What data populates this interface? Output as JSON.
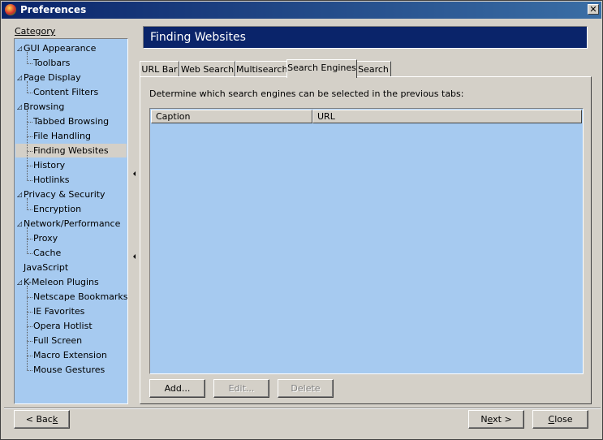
{
  "window": {
    "title": "Preferences",
    "close_glyph": "✕"
  },
  "category_label": "Category",
  "tree": [
    {
      "label": "GUI Appearance",
      "level": 0,
      "expanded": true
    },
    {
      "label": "Toolbars",
      "level": 1
    },
    {
      "label": "Page Display",
      "level": 0,
      "expanded": true
    },
    {
      "label": "Content Filters",
      "level": 1
    },
    {
      "label": "Browsing",
      "level": 0,
      "expanded": true
    },
    {
      "label": "Tabbed Browsing",
      "level": 1
    },
    {
      "label": "File Handling",
      "level": 1
    },
    {
      "label": "Finding Websites",
      "level": 1,
      "selected": true
    },
    {
      "label": "History",
      "level": 1
    },
    {
      "label": "Hotlinks",
      "level": 1
    },
    {
      "label": "Privacy & Security",
      "level": 0,
      "expanded": true
    },
    {
      "label": "Encryption",
      "level": 1
    },
    {
      "label": "Network/Performance",
      "level": 0,
      "expanded": true
    },
    {
      "label": "Proxy",
      "level": 1
    },
    {
      "label": "Cache",
      "level": 1
    },
    {
      "label": "JavaScript",
      "level": 0
    },
    {
      "label": "K-Meleon Plugins",
      "level": 0,
      "expanded": true
    },
    {
      "label": "Netscape Bookmarks",
      "level": 1
    },
    {
      "label": "IE Favorites",
      "level": 1
    },
    {
      "label": "Opera Hotlist",
      "level": 1
    },
    {
      "label": "Full Screen",
      "level": 1
    },
    {
      "label": "Macro Extension",
      "level": 1
    },
    {
      "label": "Mouse Gestures",
      "level": 1
    }
  ],
  "panel": {
    "title": "Finding Websites",
    "tabs": [
      "URL Bar",
      "Web Search",
      "Multisearch",
      "Search Engines",
      "Search"
    ],
    "active_tab": 3,
    "description": "Determine which search engines can be selected in the previous tabs:",
    "columns": [
      "Caption",
      "URL"
    ],
    "buttons": {
      "add": "Add...",
      "edit": "Edit...",
      "delete": "Delete"
    }
  },
  "footer": {
    "back": "< Back",
    "next": "Next >",
    "close": "Close"
  },
  "colors": {
    "selection_bg": "#a6caf0",
    "header_bg": "#0a246a",
    "face": "#d4d0c8"
  }
}
